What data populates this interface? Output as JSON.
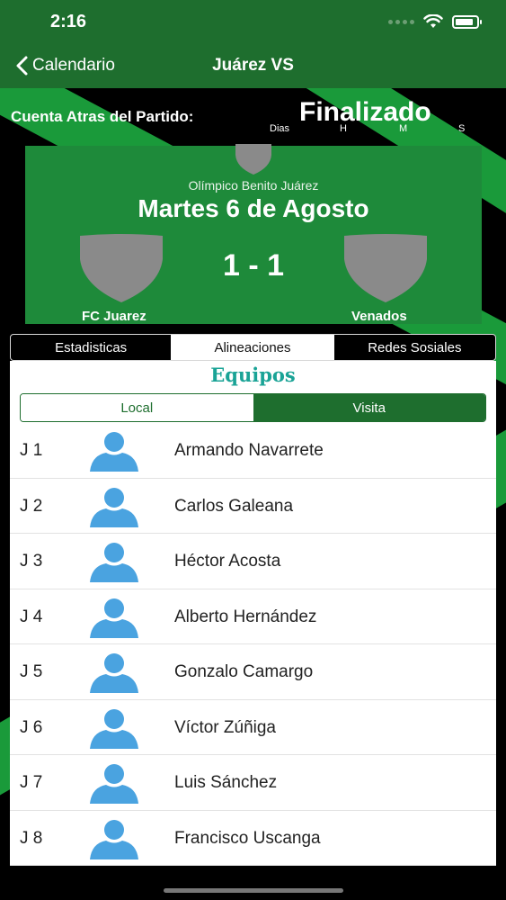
{
  "status_bar": {
    "time": "2:16"
  },
  "nav": {
    "back_label": "Calendario",
    "title": "Juárez VS"
  },
  "countdown": {
    "label": "Cuenta Atras del Partido:",
    "status": "Finalizado",
    "units": [
      "Dias",
      "H",
      "M",
      "S"
    ]
  },
  "match": {
    "stadium": "Olímpico Benito Juárez",
    "date": "Martes 6 de Agosto",
    "score": "1 - 1",
    "home_team": "FC Juarez",
    "away_team": "Venados"
  },
  "tabs": [
    {
      "label": "Estadisticas",
      "active": false
    },
    {
      "label": "Alineaciones",
      "active": true
    },
    {
      "label": "Redes Sosiales",
      "active": false
    }
  ],
  "lineup": {
    "title": "Equipos",
    "toggle": {
      "local": "Local",
      "visita": "Visita",
      "selected": "Visita"
    },
    "players": [
      {
        "number": "J 1",
        "name": "Armando Navarrete"
      },
      {
        "number": "J 2",
        "name": "Carlos Galeana"
      },
      {
        "number": "J 3",
        "name": "Héctor Acosta"
      },
      {
        "number": "J 4",
        "name": "Alberto Hernández"
      },
      {
        "number": "J 5",
        "name": "Gonzalo Camargo"
      },
      {
        "number": "J 6",
        "name": "Víctor Zúñiga"
      },
      {
        "number": "J 7",
        "name": "Luis Sánchez"
      },
      {
        "number": "J 8",
        "name": "Francisco Uscanga"
      }
    ]
  },
  "colors": {
    "header_green": "#1e6e2e",
    "card_green": "#1e8a3a",
    "title_teal": "#1aa396",
    "avatar_blue": "#4aa3e0"
  }
}
